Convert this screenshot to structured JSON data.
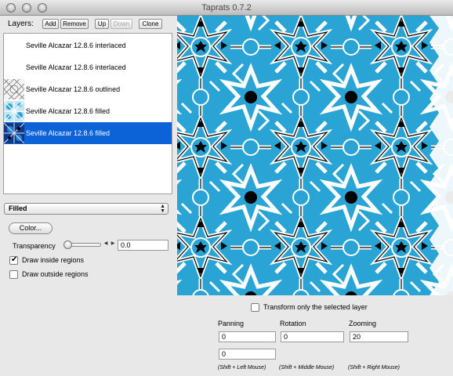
{
  "window": {
    "title": "Taprats 0.7.2"
  },
  "toolbar": {
    "layers_label": "Layers:",
    "add": "Add",
    "remove": "Remove",
    "up": "Up",
    "down": "Down",
    "clone": "Clone"
  },
  "layers": [
    {
      "name": "Seville Alcazar 12.8.6 interlaced",
      "selected": false,
      "thumbnail": "none"
    },
    {
      "name": "Seville Alcazar 12.8.6 interlaced",
      "selected": false,
      "thumbnail": "none"
    },
    {
      "name": "Seville Alcazar 12.8.6 outlined",
      "selected": false,
      "thumbnail": "outlined-pattern"
    },
    {
      "name": "Seville Alcazar 12.8.6 filled",
      "selected": false,
      "thumbnail": "cyan-filled-pattern"
    },
    {
      "name": "Seville Alcazar 12.8.6 filled",
      "selected": true,
      "thumbnail": "dark-blue-filled-pattern"
    }
  ],
  "render_mode": {
    "selected": "Filled"
  },
  "color_button": "Color...",
  "transparency": {
    "label": "Transparency",
    "value": "0.0",
    "level": 0
  },
  "options": [
    {
      "label": "Draw inside regions",
      "checked": true
    },
    {
      "label": "Draw outside regions",
      "checked": false
    }
  ],
  "canvas": {
    "pattern": "Seville Alcazar 12.8.6 star tiling",
    "fill_color": "#29a4d4",
    "line_color": "#ffffff",
    "region_color": "#000000"
  },
  "transform": {
    "selected_only_label": "Transform only the selected layer",
    "selected_only_checked": false,
    "panning_label": "Panning",
    "rotation_label": "Rotation",
    "zooming_label": "Zooming",
    "panning_x": "0",
    "panning_y": "0",
    "rotation": "0",
    "zooming": "20",
    "panning_hint": "(Shift + Left Mouse)",
    "rotation_hint": "(Shift + Middle Mouse)",
    "zooming_hint": "(Shift + Right Mouse)"
  }
}
